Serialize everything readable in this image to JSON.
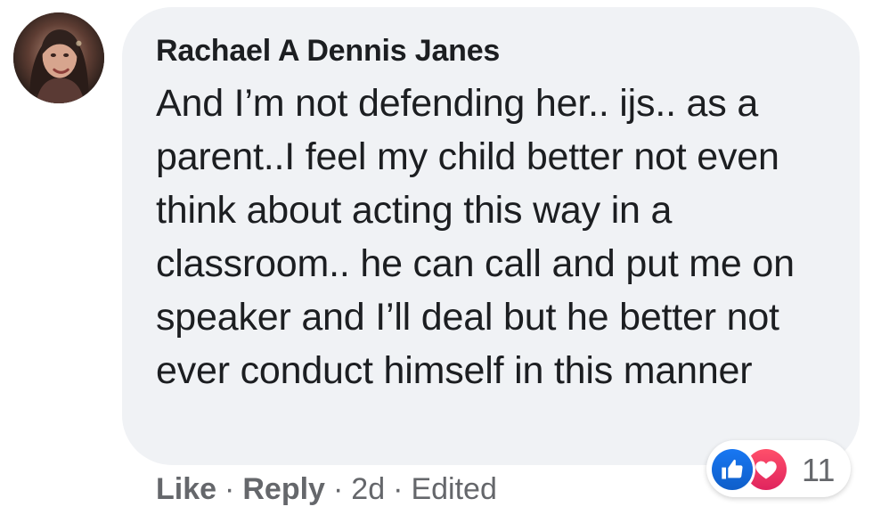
{
  "comment": {
    "author": "Rachael A Dennis Janes",
    "text": "And I’m not defending her.. ijs.. as a parent..I feel my child better not even think about acting this way in a classroom.. he can call and put me on speaker and I’ll deal but he better not ever conduct himself in this manner",
    "reactions": {
      "types": [
        "like",
        "love"
      ],
      "count": "11"
    },
    "actions": {
      "like": "Like",
      "reply": "Reply",
      "time": "2d",
      "edited": "Edited",
      "separator": "·"
    }
  },
  "colors": {
    "bubble": "#f0f2f5",
    "like_blue": "#1877f2",
    "love_red": "#e0245e",
    "secondary_text": "#65676b"
  },
  "icons": {
    "like": "thumbs-up-icon",
    "love": "heart-icon"
  }
}
